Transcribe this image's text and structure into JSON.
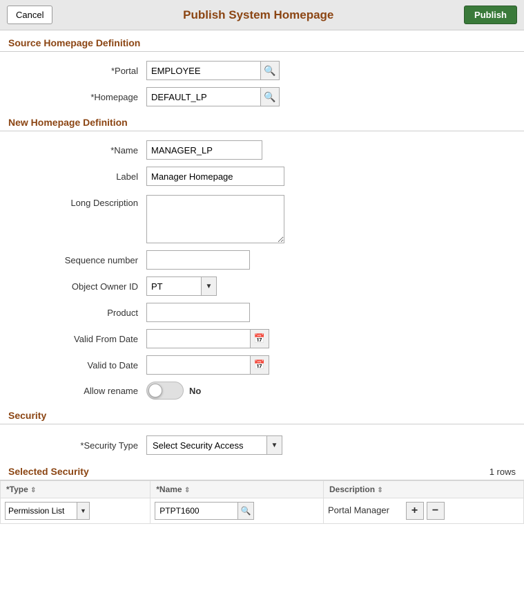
{
  "header": {
    "title": "Publish System Homepage",
    "cancel_label": "Cancel",
    "publish_label": "Publish"
  },
  "source_section": {
    "title": "Source Homepage Definition",
    "portal_label": "*Portal",
    "portal_value": "EMPLOYEE",
    "homepage_label": "*Homepage",
    "homepage_value": "DEFAULT_LP"
  },
  "new_section": {
    "title": "New Homepage Definition",
    "name_label": "*Name",
    "name_value": "MANAGER_LP",
    "label_label": "Label",
    "label_value": "Manager Homepage",
    "long_desc_label": "Long Description",
    "long_desc_value": "",
    "seq_label": "Sequence number",
    "seq_value": "",
    "owner_label": "Object Owner ID",
    "owner_value": "PT",
    "product_label": "Product",
    "product_value": "",
    "valid_from_label": "Valid From Date",
    "valid_from_value": "",
    "valid_to_label": "Valid to Date",
    "valid_to_value": "",
    "allow_rename_label": "Allow rename",
    "allow_rename_toggle": "No"
  },
  "security_section": {
    "title": "Security",
    "type_label": "*Security Type",
    "type_value": "Select Security Access"
  },
  "selected_security": {
    "title": "Selected Security",
    "rows_count": "1 rows",
    "col_type": "*Type",
    "col_name": "*Name",
    "col_description": "Description",
    "row": {
      "type": "Permission List",
      "name": "PTPT1600",
      "description": "Portal Manager"
    }
  },
  "icons": {
    "search": "🔍",
    "calendar": "📅",
    "dropdown_arrow": "▼",
    "add": "+",
    "remove": "−",
    "sort": "⇕"
  }
}
